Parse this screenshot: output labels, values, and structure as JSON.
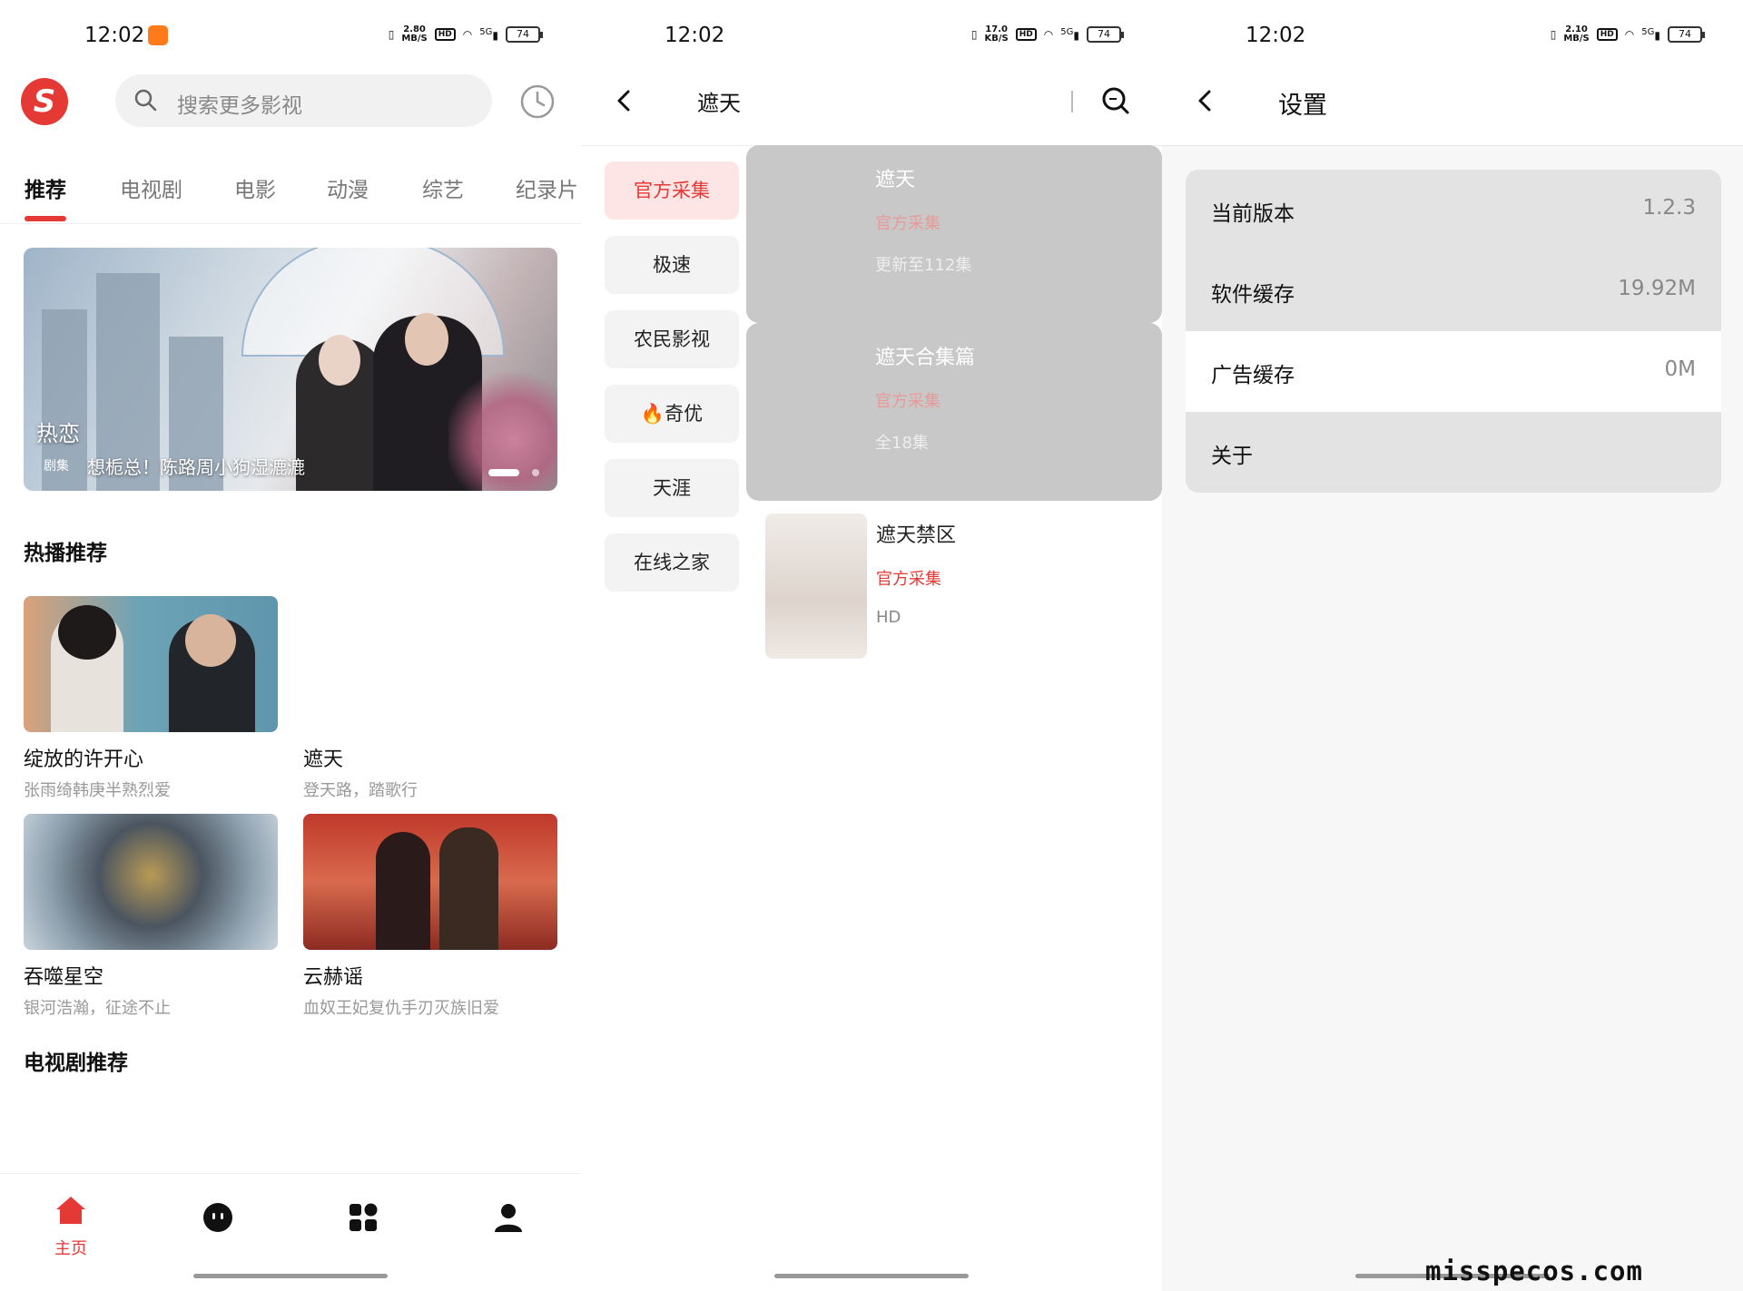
{
  "status_bars": [
    {
      "time": "12:02",
      "speed_top": "2.80",
      "speed_unit": "MB/S",
      "hd": "HD",
      "signal": "5G",
      "battery": "74"
    },
    {
      "time": "12:02",
      "speed_top": "17.0",
      "speed_unit": "KB/S",
      "hd": "HD",
      "signal": "5G",
      "battery": "74"
    },
    {
      "time": "12:02",
      "speed_top": "2.10",
      "speed_unit": "MB/S",
      "hd": "HD",
      "signal": "5G",
      "battery": "74"
    }
  ],
  "home": {
    "logo": "S",
    "search_placeholder": "搜索更多影视",
    "categories": [
      "推荐",
      "电视剧",
      "电影",
      "动漫",
      "综艺",
      "纪录片"
    ],
    "banner": {
      "title": "热恋",
      "tag": "剧集",
      "desc": "想栀总！陈路周小狗湿漉漉"
    },
    "hot_title": "热播推荐",
    "cards": [
      {
        "title": "绽放的许开心",
        "sub": "张雨绮韩庚半熟烈爱"
      },
      {
        "title": "遮天",
        "sub": "登天路，踏歌行"
      },
      {
        "title": "吞噬星空",
        "sub": "银河浩瀚，征途不止"
      },
      {
        "title": "云赫谣",
        "sub": "血奴王妃复仇手刃灭族旧爱"
      }
    ],
    "tv_title": "电视剧推荐",
    "tabbar": {
      "home_label": "主页"
    }
  },
  "search_results": {
    "title": "遮天",
    "sources": [
      "官方采集",
      "极速",
      "农民影视",
      "🔥奇优",
      "天涯",
      "在线之家"
    ],
    "results": [
      {
        "name": "遮天",
        "source": "官方采集",
        "status": "更新至112集"
      },
      {
        "name": "遮天合集篇",
        "source": "官方采集",
        "status": "全18集"
      },
      {
        "name": "遮天禁区",
        "source": "官方采集",
        "status": "HD"
      }
    ]
  },
  "settings": {
    "title": "设置",
    "rows": [
      {
        "label": "当前版本",
        "value": "1.2.3"
      },
      {
        "label": "软件缓存",
        "value": "19.92M"
      },
      {
        "label": "广告缓存",
        "value": "0M"
      },
      {
        "label": "关于",
        "value": ""
      }
    ]
  },
  "watermark": "misspecos.com",
  "colors": {
    "accent": "#e53935",
    "accent_light": "#fde5e5"
  }
}
